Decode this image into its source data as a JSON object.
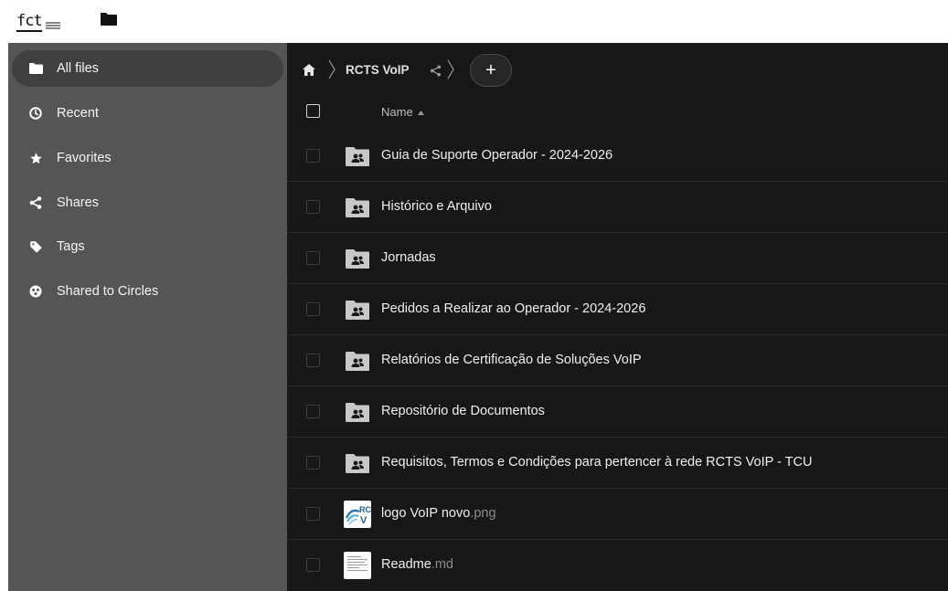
{
  "app": {
    "logo_text": "fct"
  },
  "sidebar": {
    "items": [
      {
        "label": "All files",
        "icon": "folder-icon",
        "active": true
      },
      {
        "label": "Recent",
        "icon": "clock-icon"
      },
      {
        "label": "Favorites",
        "icon": "star-icon"
      },
      {
        "label": "Shares",
        "icon": "share-icon"
      },
      {
        "label": "Tags",
        "icon": "tag-icon"
      },
      {
        "label": "Shared to Circles",
        "icon": "circles-icon"
      }
    ]
  },
  "breadcrumb": {
    "home_icon": "home-icon",
    "current": "RCTS VoIP",
    "add_label": "+"
  },
  "table": {
    "column_name": "Name",
    "sort": "ascending",
    "rows": [
      {
        "name": "Guia de Suporte Operador - 2024-2026",
        "ext": "",
        "type": "shared-folder"
      },
      {
        "name": "Histórico e Arquivo",
        "ext": "",
        "type": "shared-folder"
      },
      {
        "name": "Jornadas",
        "ext": "",
        "type": "shared-folder"
      },
      {
        "name": "Pedidos a Realizar ao Operador - 2024-2026",
        "ext": "",
        "type": "shared-folder"
      },
      {
        "name": "Relatórios de Certificação de Soluções VoIP",
        "ext": "",
        "type": "shared-folder"
      },
      {
        "name": "Repositório de Documentos",
        "ext": "",
        "type": "shared-folder"
      },
      {
        "name": "Requisitos, Termos e Condições para pertencer à rede RCTS VoIP - TCU",
        "ext": "",
        "type": "shared-folder"
      },
      {
        "name": "logo VoIP novo",
        "ext": ".png",
        "type": "image"
      },
      {
        "name": "Readme",
        "ext": ".md",
        "type": "text"
      }
    ]
  },
  "colors": {
    "sidebar_bg": "#555555",
    "sidebar_active": "#404040",
    "main_bg": "#171717",
    "row_border": "#2b2b2b",
    "folder": "#c8c8c8"
  }
}
